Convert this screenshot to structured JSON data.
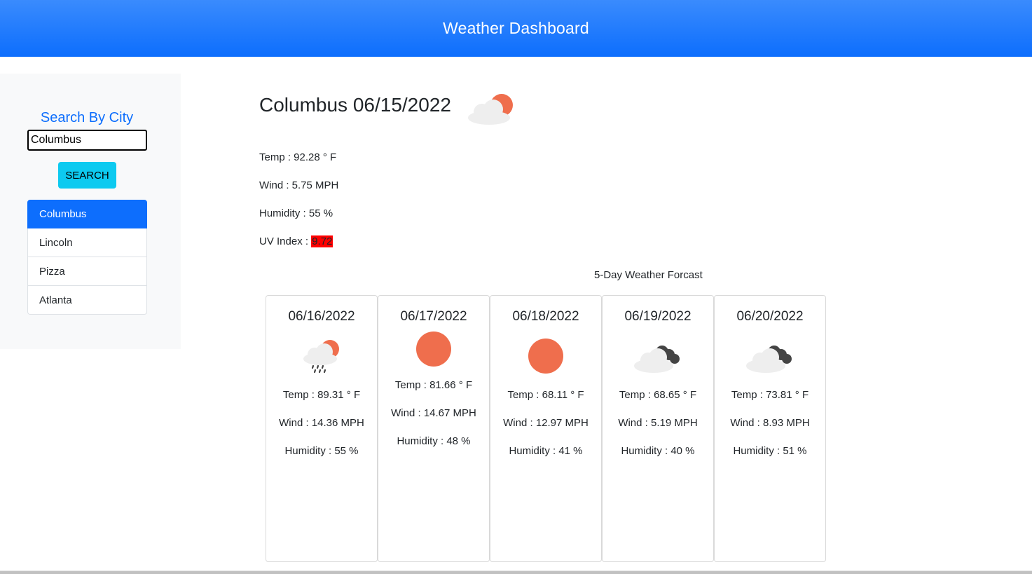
{
  "header": {
    "title": "Weather Dashboard"
  },
  "sidebar": {
    "search_title": "Search By City",
    "search_value": "Columbus",
    "search_button": "SEARCH",
    "history": [
      "Columbus",
      "Lincoln",
      "Pizza",
      "Atlanta"
    ],
    "active_index": 0
  },
  "current": {
    "title": "Columbus 06/15/2022",
    "icon": "partly-cloudy-sun-icon",
    "temp": "Temp : 92.28 ° F",
    "wind": "Wind : 5.75 MPH",
    "humidity": "Humidity : 55 %",
    "uv_label": "UV Index : ",
    "uv_value": "9.72",
    "uv_color": "#ff0000"
  },
  "forecast": {
    "title": "5-Day Weather Forcast",
    "days": [
      {
        "date": "06/16/2022",
        "icon": "rain-sun-cloud-icon",
        "temp": "Temp : 89.31 ° F",
        "wind": "Wind : 14.36 MPH",
        "humidity": "Humidity : 55 %"
      },
      {
        "date": "06/17/2022",
        "icon": "sun-icon",
        "temp": "Temp : 81.66 ° F",
        "wind": "Wind : 14.67 MPH",
        "humidity": "Humidity : 48 %"
      },
      {
        "date": "06/18/2022",
        "icon": "sun-icon",
        "temp": "Temp : 68.11 ° F",
        "wind": "Wind : 12.97 MPH",
        "humidity": "Humidity : 41 %"
      },
      {
        "date": "06/19/2022",
        "icon": "dark-clouds-icon",
        "temp": "Temp : 68.65 ° F",
        "wind": "Wind : 5.19 MPH",
        "humidity": "Humidity : 40 %"
      },
      {
        "date": "06/20/2022",
        "icon": "dark-clouds-icon",
        "temp": "Temp : 73.81 ° F",
        "wind": "Wind : 8.93 MPH",
        "humidity": "Humidity : 51 %"
      }
    ]
  },
  "colors": {
    "accent": "#0d6efd",
    "search_button": "#0dcaf0",
    "sun": "#ef6e4d",
    "cloud_light": "#eeeeee",
    "cloud_dark": "#444444"
  }
}
